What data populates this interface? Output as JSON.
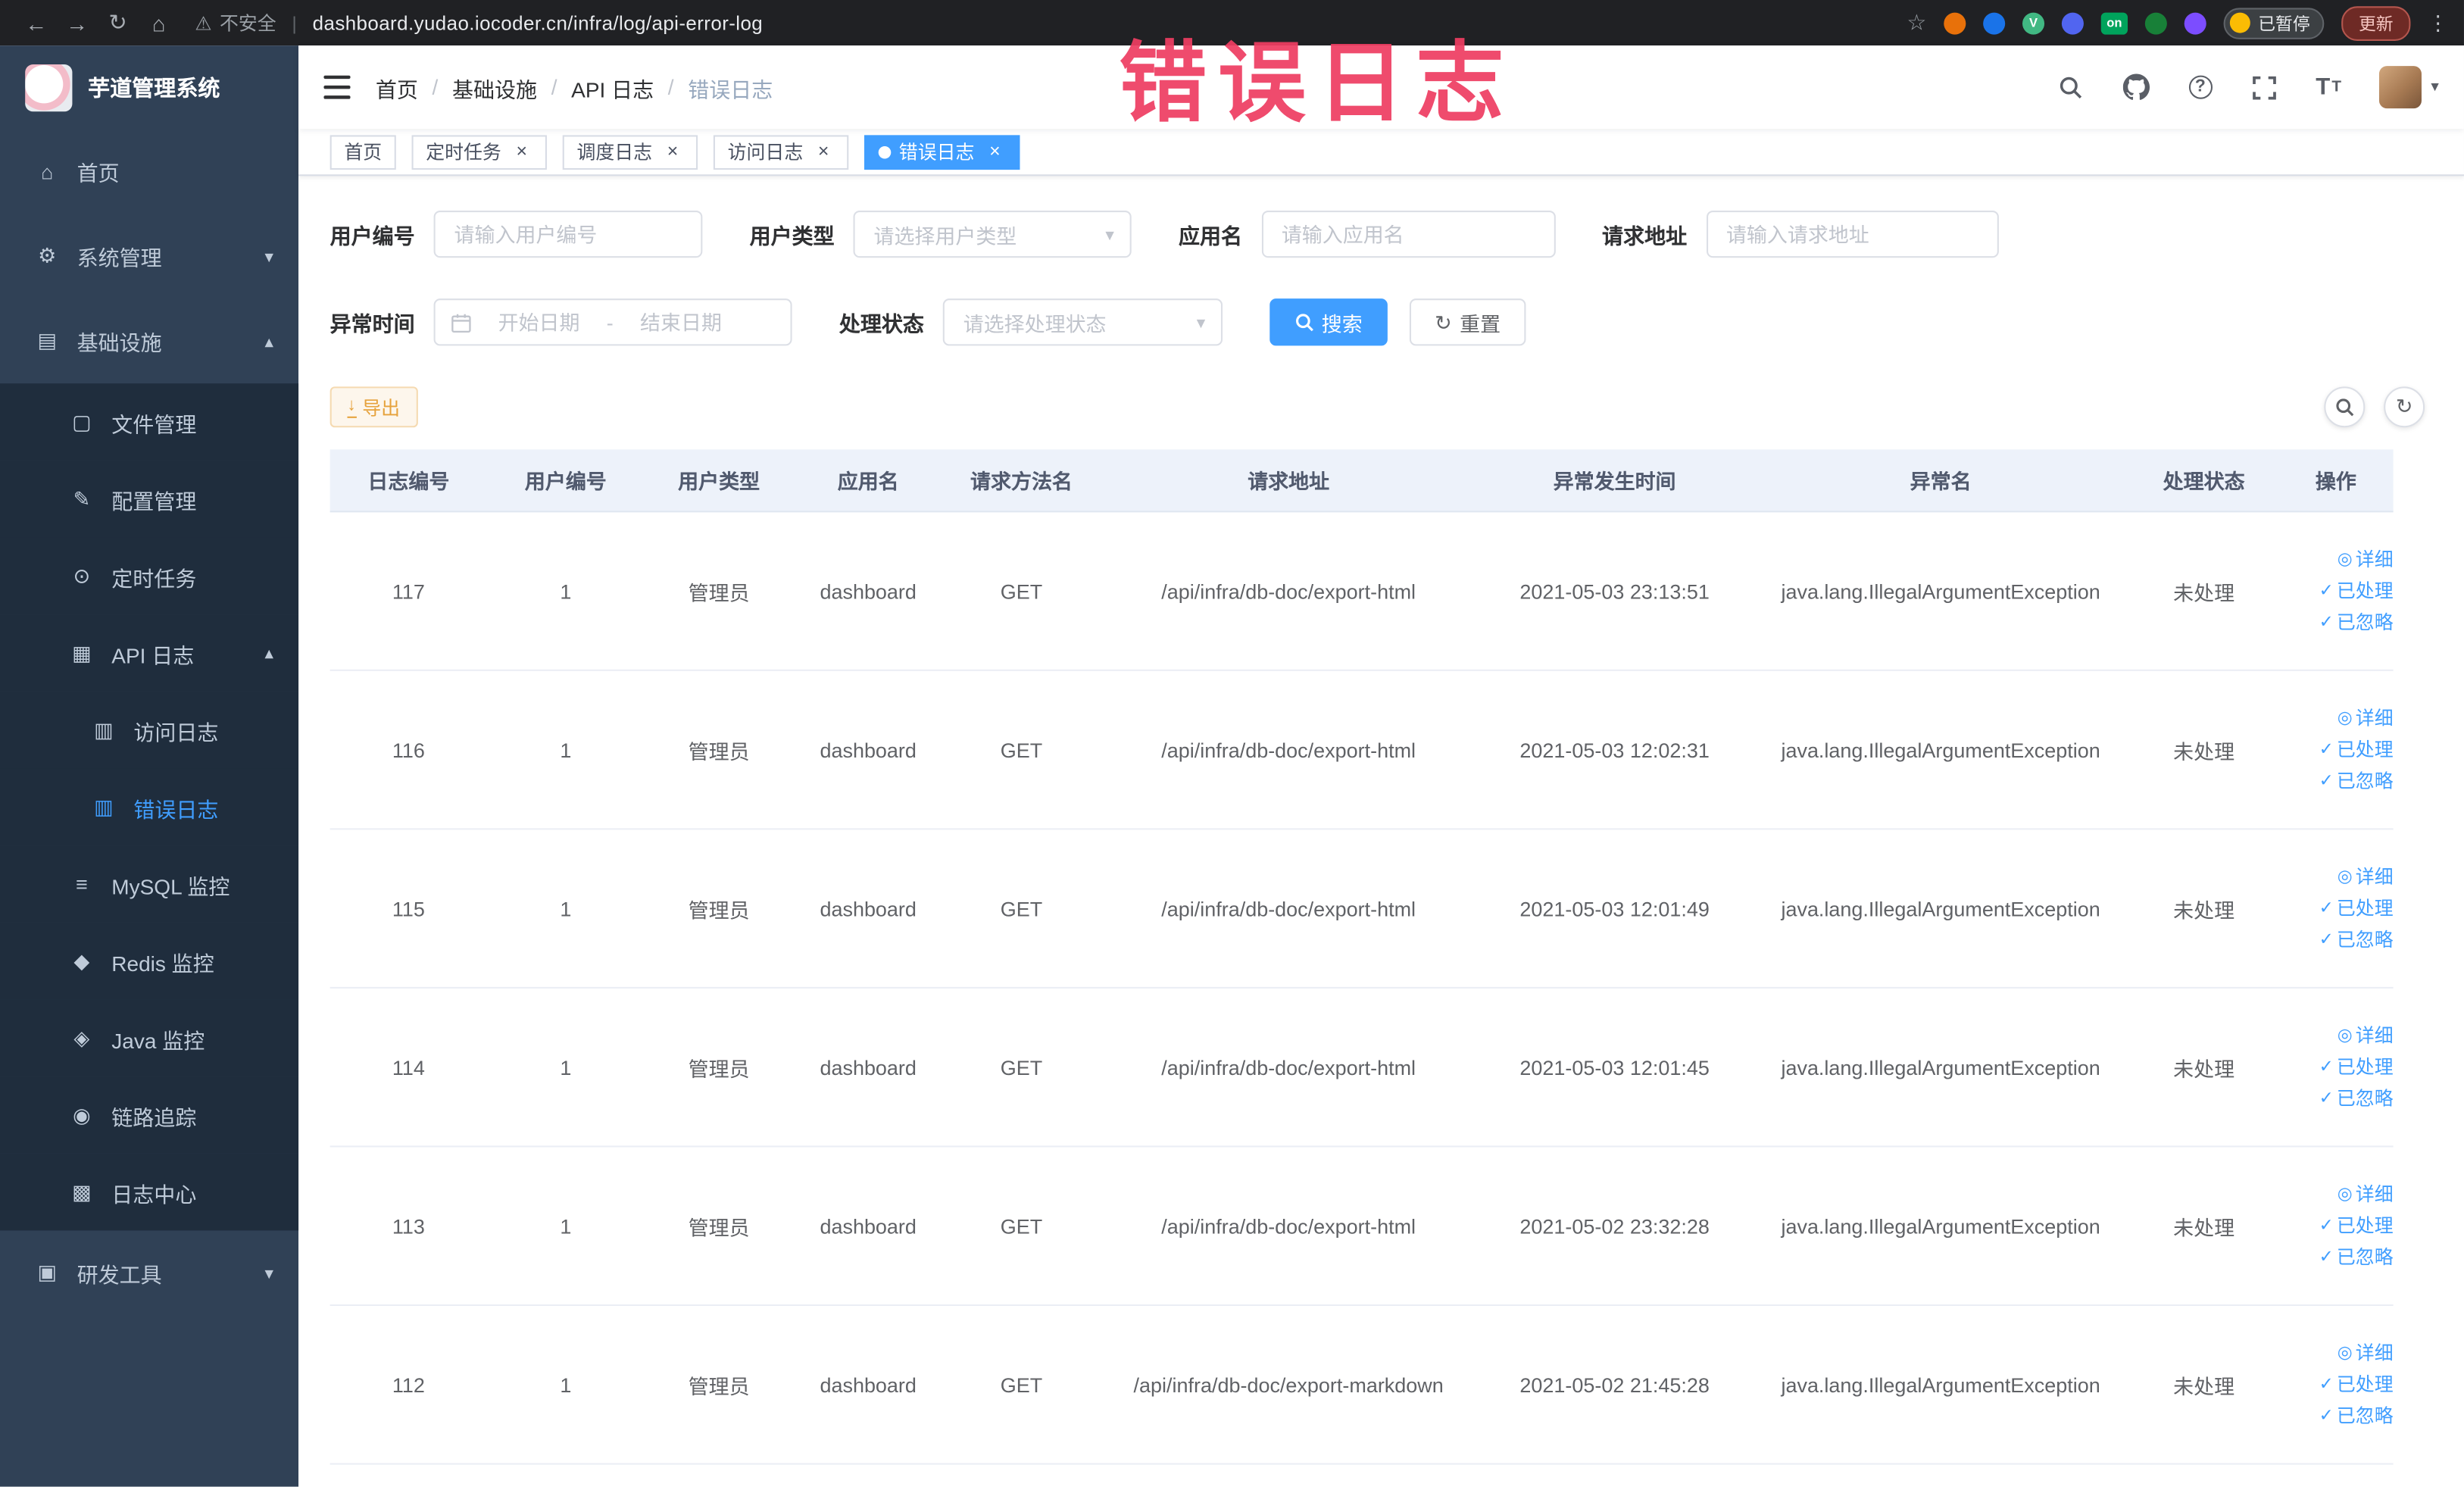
{
  "annotation": {
    "text": "错误日志"
  },
  "browser": {
    "back_glyph": "←",
    "forward_glyph": "→",
    "reload_glyph": "↻",
    "home_glyph": "⌂",
    "warning_glyph": "⚠",
    "security_label": "不安全",
    "divider_glyph": "|",
    "url": "dashboard.yudao.iocoder.cn/infra/log/api-error-log",
    "star_glyph": "☆",
    "extensions": [
      {
        "name": "extension-icon-orange",
        "bg": "#e8710a"
      },
      {
        "name": "extension-icon-blue",
        "bg": "#1a73e8"
      },
      {
        "name": "extension-icon-vue",
        "bg": "#41b883",
        "label": "V"
      },
      {
        "name": "extension-icon-indigo",
        "bg": "#5165f0"
      },
      {
        "name": "extension-icon-on-badge",
        "bg": "#00a35c",
        "label": "on",
        "rect": true
      },
      {
        "name": "extension-icon-green",
        "bg": "#188038"
      },
      {
        "name": "extension-icon-purple",
        "bg": "#7c4dff"
      }
    ],
    "paused_label": "已暂停",
    "update_label": "更新",
    "menu_glyph": "⋮"
  },
  "icons": {
    "caret": "▾",
    "refresh": "↻",
    "download": "↓",
    "help": "?",
    "font_big": "T",
    "font_small": "T"
  },
  "sidebar": {
    "app_title": "芋道管理系统",
    "items": [
      {
        "name": "sidebar-item-home",
        "icon": "home-icon",
        "glyph": "⌂",
        "label": "首页",
        "level": 0
      },
      {
        "name": "sidebar-item-system",
        "icon": "gear-icon",
        "glyph": "⚙",
        "label": "系统管理",
        "level": 0,
        "chevron": "▾"
      },
      {
        "name": "sidebar-item-infra",
        "icon": "infra-icon",
        "glyph": "▤",
        "label": "基础设施",
        "level": 0,
        "chevron": "▴"
      },
      {
        "name": "sidebar-item-file",
        "icon": "file-icon",
        "glyph": "▢",
        "label": "文件管理",
        "level": 1,
        "sub": true
      },
      {
        "name": "sidebar-item-config",
        "icon": "edit-icon",
        "glyph": "✎",
        "label": "配置管理",
        "level": 1,
        "sub": true
      },
      {
        "name": "sidebar-item-cron",
        "icon": "timer-icon",
        "glyph": "⊙",
        "label": "定时任务",
        "level": 1,
        "sub": true
      },
      {
        "name": "sidebar-item-api-log",
        "icon": "api-log-icon",
        "glyph": "▦",
        "label": "API 日志",
        "level": 1,
        "sub": true,
        "chevron": "▴"
      },
      {
        "name": "sidebar-item-access-log",
        "icon": "access-log-icon",
        "glyph": "▥",
        "label": "访问日志",
        "level": 2,
        "sub": true
      },
      {
        "name": "sidebar-item-error-log",
        "icon": "error-log-icon",
        "glyph": "▥",
        "label": "错误日志",
        "level": 2,
        "sub": true,
        "active": true
      },
      {
        "name": "sidebar-item-mysql",
        "icon": "database-icon",
        "glyph": "≡",
        "label": "MySQL 监控",
        "level": 1,
        "sub": true
      },
      {
        "name": "sidebar-item-redis",
        "icon": "redis-icon",
        "glyph": "◆",
        "label": "Redis 监控",
        "level": 1,
        "sub": true
      },
      {
        "name": "sidebar-item-java",
        "icon": "java-icon",
        "glyph": "◈",
        "label": "Java 监控",
        "level": 1,
        "sub": true
      },
      {
        "name": "sidebar-item-trace",
        "icon": "trace-icon",
        "glyph": "◉",
        "label": "链路追踪",
        "level": 1,
        "sub": true
      },
      {
        "name": "sidebar-item-log-center",
        "icon": "log-center-icon",
        "glyph": "▩",
        "label": "日志中心",
        "level": 1,
        "sub": true
      },
      {
        "name": "sidebar-item-dev-tools",
        "icon": "tools-icon",
        "glyph": "▣",
        "label": "研发工具",
        "level": 0,
        "chevron": "▾"
      }
    ]
  },
  "breadcrumb": {
    "separator": "/",
    "items": [
      {
        "label": "首页"
      },
      {
        "label": "基础设施"
      },
      {
        "label": "API 日志"
      },
      {
        "label": "错误日志",
        "last": true
      }
    ]
  },
  "navbar_icons": [
    "search-icon",
    "github-icon",
    "help-icon",
    "fullscreen-icon",
    "font-size-icon",
    "user-avatar",
    "chevron-down-icon"
  ],
  "tabbar": {
    "close_glyph": "×"
  },
  "tabs": [
    {
      "name": "tab-home",
      "label": "首页"
    },
    {
      "name": "tab-cron",
      "label": "定时任务",
      "closable": true
    },
    {
      "name": "tab-job-log",
      "label": "调度日志",
      "closable": true
    },
    {
      "name": "tab-access-log",
      "label": "访问日志",
      "closable": true
    },
    {
      "name": "tab-error-log",
      "label": "错误日志",
      "closable": true,
      "active": true
    }
  ],
  "filters": {
    "user_id": {
      "label": "用户编号",
      "placeholder": "请输入用户编号"
    },
    "user_type": {
      "label": "用户类型",
      "placeholder": "请选择用户类型"
    },
    "app_name": {
      "label": "应用名",
      "placeholder": "请输入应用名"
    },
    "request_url": {
      "label": "请求地址",
      "placeholder": "请输入请求地址"
    },
    "exception_time": {
      "label": "异常时间",
      "start_placeholder": "开始日期",
      "separator": "-",
      "end_placeholder": "结束日期"
    },
    "process_status": {
      "label": "处理状态",
      "placeholder": "请选择处理状态"
    },
    "search_button": "搜索",
    "reset_button": "重置"
  },
  "toolbar": {
    "export_label": "导出"
  },
  "table": {
    "columns": [
      {
        "label": "日志编号"
      },
      {
        "label": "用户编号"
      },
      {
        "label": "用户类型"
      },
      {
        "label": "应用名"
      },
      {
        "label": "请求方法名"
      },
      {
        "label": "请求地址"
      },
      {
        "label": "异常发生时间"
      },
      {
        "label": "异常名"
      },
      {
        "label": "处理状态"
      },
      {
        "label": "操作"
      }
    ],
    "actions": [
      {
        "name": "detail",
        "glyph": "◎",
        "label": "详细"
      },
      {
        "name": "processed",
        "glyph": "✓",
        "label": "已处理"
      },
      {
        "name": "ignored",
        "glyph": "✓",
        "label": "已忽略"
      }
    ],
    "rows": [
      {
        "id": "117",
        "user_id": "1",
        "user_type": "管理员",
        "app": "dashboard",
        "method": "GET",
        "url": "/api/infra/db-doc/export-html",
        "time": "2021-05-03 23:13:51",
        "exception": "java.lang.IllegalArgumentException",
        "status": "未处理"
      },
      {
        "id": "116",
        "user_id": "1",
        "user_type": "管理员",
        "app": "dashboard",
        "method": "GET",
        "url": "/api/infra/db-doc/export-html",
        "time": "2021-05-03 12:02:31",
        "exception": "java.lang.IllegalArgumentException",
        "status": "未处理"
      },
      {
        "id": "115",
        "user_id": "1",
        "user_type": "管理员",
        "app": "dashboard",
        "method": "GET",
        "url": "/api/infra/db-doc/export-html",
        "time": "2021-05-03 12:01:49",
        "exception": "java.lang.IllegalArgumentException",
        "status": "未处理"
      },
      {
        "id": "114",
        "user_id": "1",
        "user_type": "管理员",
        "app": "dashboard",
        "method": "GET",
        "url": "/api/infra/db-doc/export-html",
        "time": "2021-05-03 12:01:45",
        "exception": "java.lang.IllegalArgumentException",
        "status": "未处理"
      },
      {
        "id": "113",
        "user_id": "1",
        "user_type": "管理员",
        "app": "dashboard",
        "method": "GET",
        "url": "/api/infra/db-doc/export-html",
        "time": "2021-05-02 23:32:28",
        "exception": "java.lang.IllegalArgumentException",
        "status": "未处理"
      },
      {
        "id": "112",
        "user_id": "1",
        "user_type": "管理员",
        "app": "dashboard",
        "method": "GET",
        "url": "/api/infra/db-doc/export-markdown",
        "time": "2021-05-02 21:45:28",
        "exception": "java.lang.IllegalArgumentException",
        "status": "未处理"
      }
    ]
  },
  "colors": {
    "primary": "#409eff",
    "sidebar_bg": "#304156",
    "submenu_bg": "#1f2d3d",
    "warning": "#e6a23c",
    "annotation_red": "#ee3e62",
    "table_header_bg": "#edf2fa"
  }
}
